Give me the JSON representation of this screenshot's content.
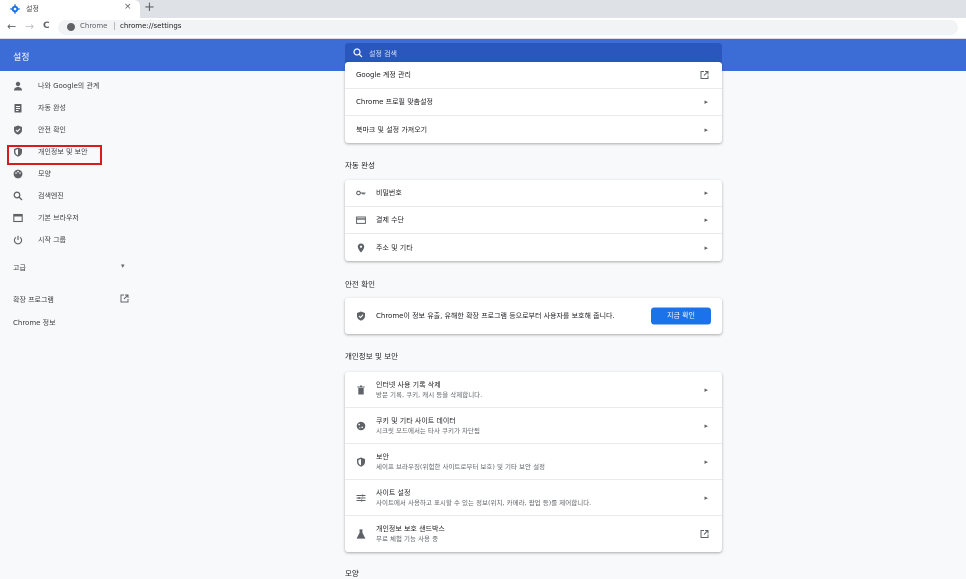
{
  "tab": {
    "title": "설정",
    "close": "×",
    "new_tab": "+"
  },
  "address": {
    "back": "←",
    "forward": "→",
    "reload": "C",
    "chrome_label": "Chrome",
    "separator": "|",
    "url": "chrome://settings"
  },
  "header": {
    "title": "설정",
    "search_placeholder": "설정 검색"
  },
  "sidebar": {
    "items": [
      {
        "label": "나와 Google의 관계",
        "icon": "person-icon"
      },
      {
        "label": "자동 완성",
        "icon": "clipboard-icon"
      },
      {
        "label": "안전 확인",
        "icon": "shield-check-icon"
      },
      {
        "label": "개인정보 및 보안",
        "icon": "shield-half-icon"
      },
      {
        "label": "모양",
        "icon": "palette-icon"
      },
      {
        "label": "검색엔진",
        "icon": "search-icon"
      },
      {
        "label": "기본 브라우저",
        "icon": "browser-icon"
      },
      {
        "label": "시작 그룹",
        "icon": "power-icon"
      }
    ],
    "advanced": "고급",
    "advanced_chevron": "▾",
    "extensions": "확장 프로그램",
    "about": "Chrome 정보"
  },
  "you_and_google": {
    "rows": [
      {
        "label": "Google 계정 관리"
      },
      {
        "label": "Chrome 프로필 맞춤설정",
        "arrow": "▸"
      },
      {
        "label": "북마크 및 설정 가져오기",
        "arrow": "▸"
      }
    ]
  },
  "autofill": {
    "title": "자동 완성",
    "rows": [
      {
        "label": "비밀번호",
        "icon": "key-icon",
        "arrow": "▸"
      },
      {
        "label": "결제 수단",
        "icon": "credit-card-icon",
        "arrow": "▸"
      },
      {
        "label": "주소 및 기타",
        "icon": "location-pin-icon",
        "arrow": "▸"
      }
    ]
  },
  "safety_check": {
    "title": "안전 확인",
    "message": "Chrome이 정보 유출, 유해한 확장 프로그램 등으로부터 사용자를 보호해 줍니다.",
    "button": "지금 확인"
  },
  "privacy": {
    "title": "개인정보 및 보안",
    "rows": [
      {
        "title": "인터넷 사용 기록 삭제",
        "subtitle": "방문 기록, 쿠키, 캐시 등을 삭제합니다.",
        "icon": "trash-icon",
        "arrow": "▸"
      },
      {
        "title": "쿠키 및 기타 사이트 데이터",
        "subtitle": "시크릿 모드에서는 타사 쿠키가 차단됨",
        "icon": "cookie-icon",
        "arrow": "▸"
      },
      {
        "title": "보안",
        "subtitle": "세이프 브라우징(위험한 사이트로부터 보호) 및 기타 보안 설정",
        "icon": "shield-half-icon",
        "arrow": "▸"
      },
      {
        "title": "사이트 설정",
        "subtitle": "사이트에서 사용하고 표시할 수 있는 정보(위치, 카메라, 팝업 등)를 제어합니다.",
        "icon": "sliders-icon",
        "arrow": "▸"
      },
      {
        "title": "개인정보 보호 샌드박스",
        "subtitle": "무료 체험 기능 사용 중",
        "icon": "flask-icon"
      }
    ]
  },
  "appearance": {
    "title": "모양"
  },
  "colors": {
    "header_blue": "#3c6cd6",
    "button_blue": "#1a73e8",
    "highlight_red": "#d81b1b"
  }
}
